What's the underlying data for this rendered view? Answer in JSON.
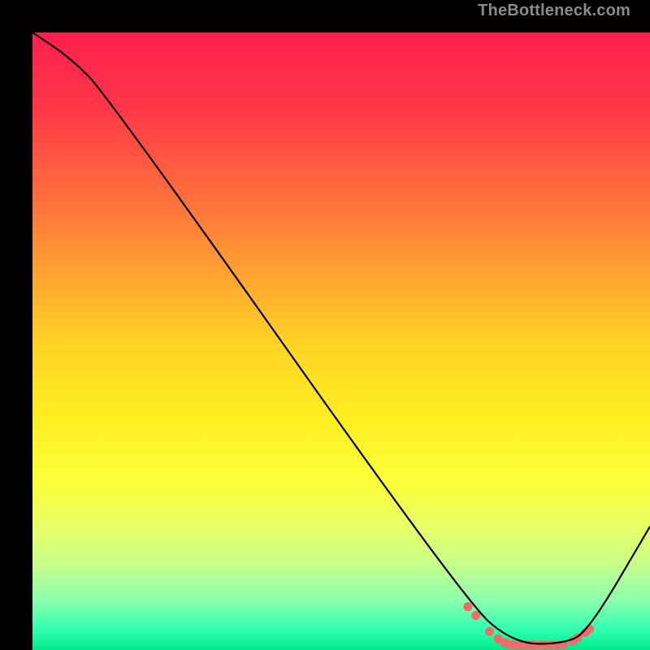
{
  "watermark": "TheBottleneck.com",
  "chart_data": {
    "type": "line",
    "title": "",
    "xlabel": "",
    "ylabel": "",
    "xlim": [
      0,
      100
    ],
    "ylim": [
      0,
      100
    ],
    "series": [
      {
        "name": "bottleneck-curve",
        "x": [
          0,
          6,
          12,
          70,
          78,
          86,
          90,
          100
        ],
        "y": [
          100,
          96,
          90,
          8,
          1,
          1,
          3,
          20
        ]
      }
    ],
    "marker_points": {
      "name": "highlight-dots",
      "x": [
        70.5,
        71.8,
        74,
        75.4,
        76.5,
        77.3,
        78,
        79,
        80,
        80.8,
        81.5,
        82.3,
        83,
        84,
        85,
        86,
        87.5,
        88.3,
        89.5,
        90.2
      ],
      "y": [
        7.0,
        5.6,
        3.0,
        1.8,
        1.2,
        0.9,
        0.8,
        0.8,
        0.8,
        0.8,
        0.8,
        0.8,
        0.8,
        0.8,
        0.8,
        0.9,
        1.5,
        2.0,
        2.8,
        3.4
      ]
    },
    "gradient_stops": [
      {
        "offset": 0.0,
        "color": "#ff1f4b"
      },
      {
        "offset": 0.12,
        "color": "#ff3648"
      },
      {
        "offset": 0.3,
        "color": "#ff7b3a"
      },
      {
        "offset": 0.5,
        "color": "#ffd225"
      },
      {
        "offset": 0.62,
        "color": "#ffee20"
      },
      {
        "offset": 0.73,
        "color": "#fbff3a"
      },
      {
        "offset": 0.8,
        "color": "#e8ff66"
      },
      {
        "offset": 0.86,
        "color": "#c8ff8a"
      },
      {
        "offset": 0.92,
        "color": "#8affad"
      },
      {
        "offset": 0.97,
        "color": "#2bffb0"
      },
      {
        "offset": 1.0,
        "color": "#00e888"
      }
    ],
    "marker_color": "#f26a6a",
    "curve_color": "#000000"
  }
}
